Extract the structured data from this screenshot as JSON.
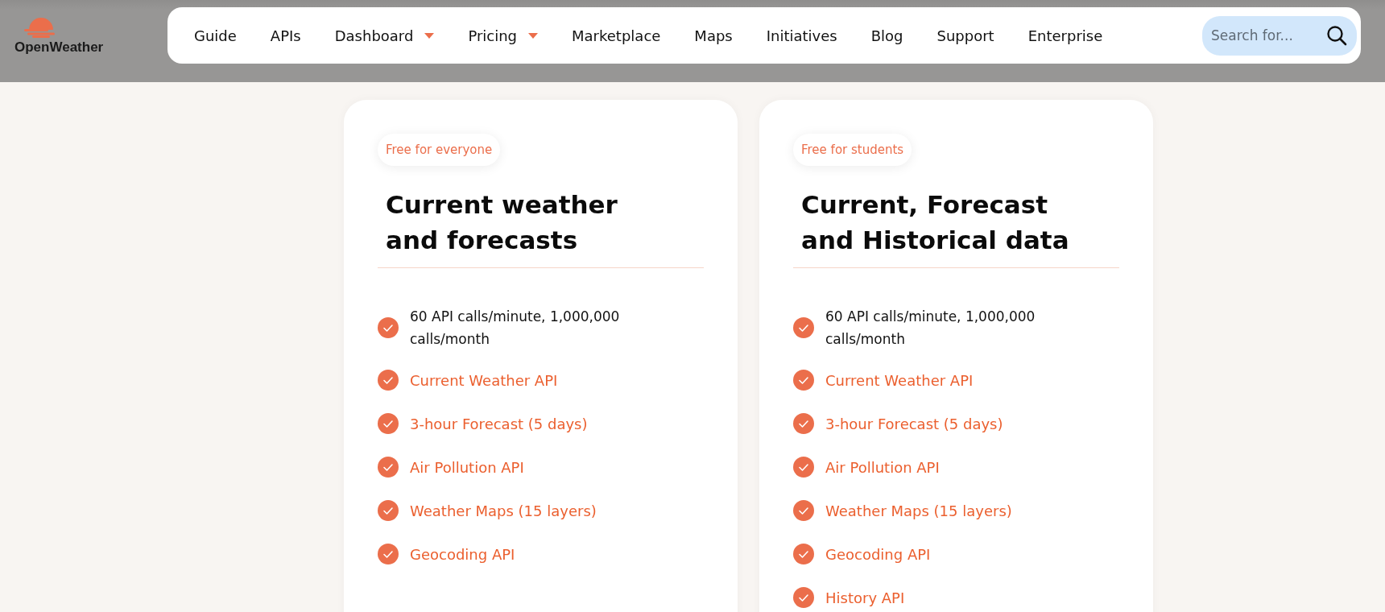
{
  "header": {
    "logo_text": "OpenWeather",
    "nav": [
      {
        "label": "Guide",
        "dropdown": false
      },
      {
        "label": "APIs",
        "dropdown": false
      },
      {
        "label": "Dashboard",
        "dropdown": true
      },
      {
        "label": "Pricing",
        "dropdown": true
      },
      {
        "label": "Marketplace",
        "dropdown": false
      },
      {
        "label": "Maps",
        "dropdown": false
      },
      {
        "label": "Initiatives",
        "dropdown": false
      },
      {
        "label": "Blog",
        "dropdown": false
      },
      {
        "label": "Support",
        "dropdown": false
      },
      {
        "label": "Enterprise",
        "dropdown": false
      }
    ],
    "search": {
      "placeholder": "Search for..."
    }
  },
  "plans": [
    {
      "badge": "Free for everyone",
      "title_lines": [
        "Current weather",
        "and forecasts"
      ],
      "features": [
        {
          "kind": "text",
          "text": "60 API calls/minute, 1,000,000 calls/month"
        },
        {
          "kind": "link",
          "text": "Current Weather API"
        },
        {
          "kind": "link",
          "text": "3-hour Forecast (5 days)"
        },
        {
          "kind": "link",
          "text": "Air Pollution API"
        },
        {
          "kind": "link",
          "text": "Weather Maps (15 layers)"
        },
        {
          "kind": "link",
          "text": "Geocoding API"
        }
      ]
    },
    {
      "badge": "Free for students",
      "title_lines": [
        "Current, Forecast",
        "and Historical data"
      ],
      "features": [
        {
          "kind": "text",
          "text": "60 API calls/minute, 1,000,000 calls/month"
        },
        {
          "kind": "link",
          "text": "Current Weather API"
        },
        {
          "kind": "link",
          "text": "3-hour Forecast (5 days)"
        },
        {
          "kind": "link",
          "text": "Air Pollution API"
        },
        {
          "kind": "link",
          "text": "Weather Maps (15 layers)"
        },
        {
          "kind": "link",
          "text": "Geocoding API"
        },
        {
          "kind": "link",
          "text": "History API"
        }
      ]
    }
  ]
}
